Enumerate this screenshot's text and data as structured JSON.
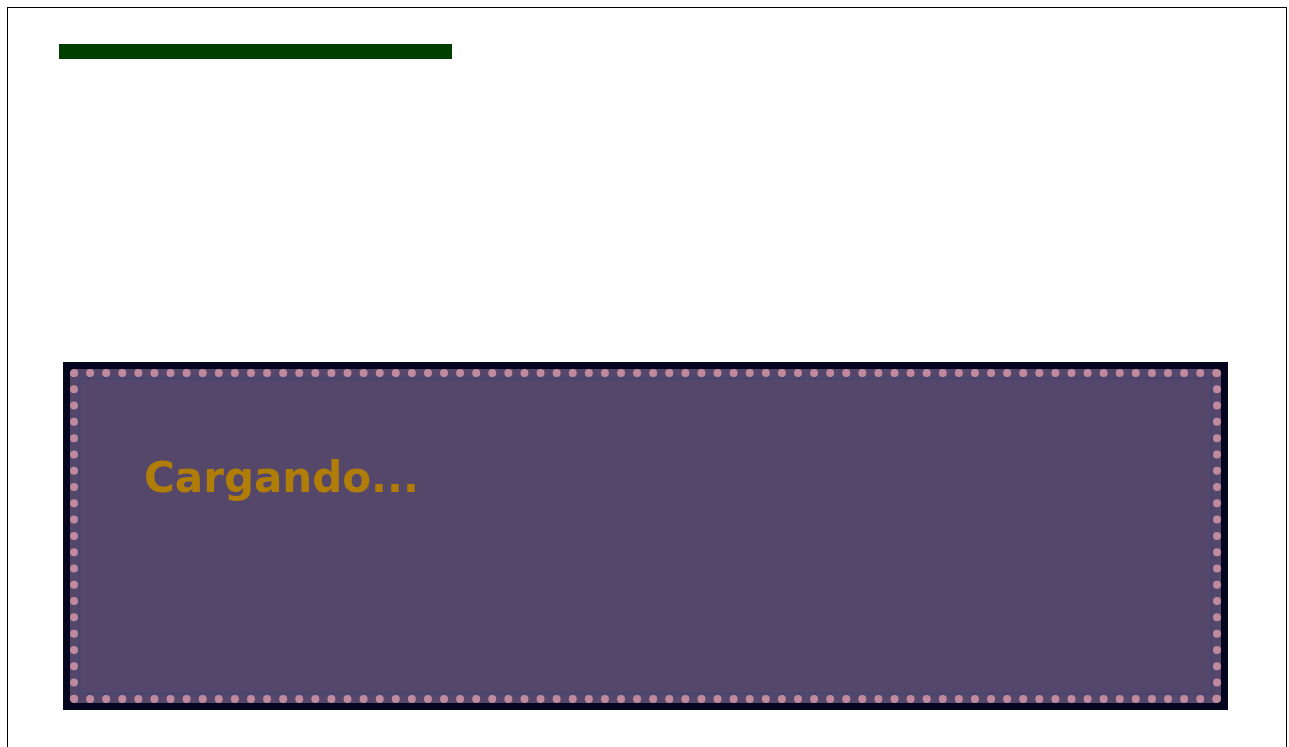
{
  "loading_panel": {
    "message": "Cargando..."
  }
}
